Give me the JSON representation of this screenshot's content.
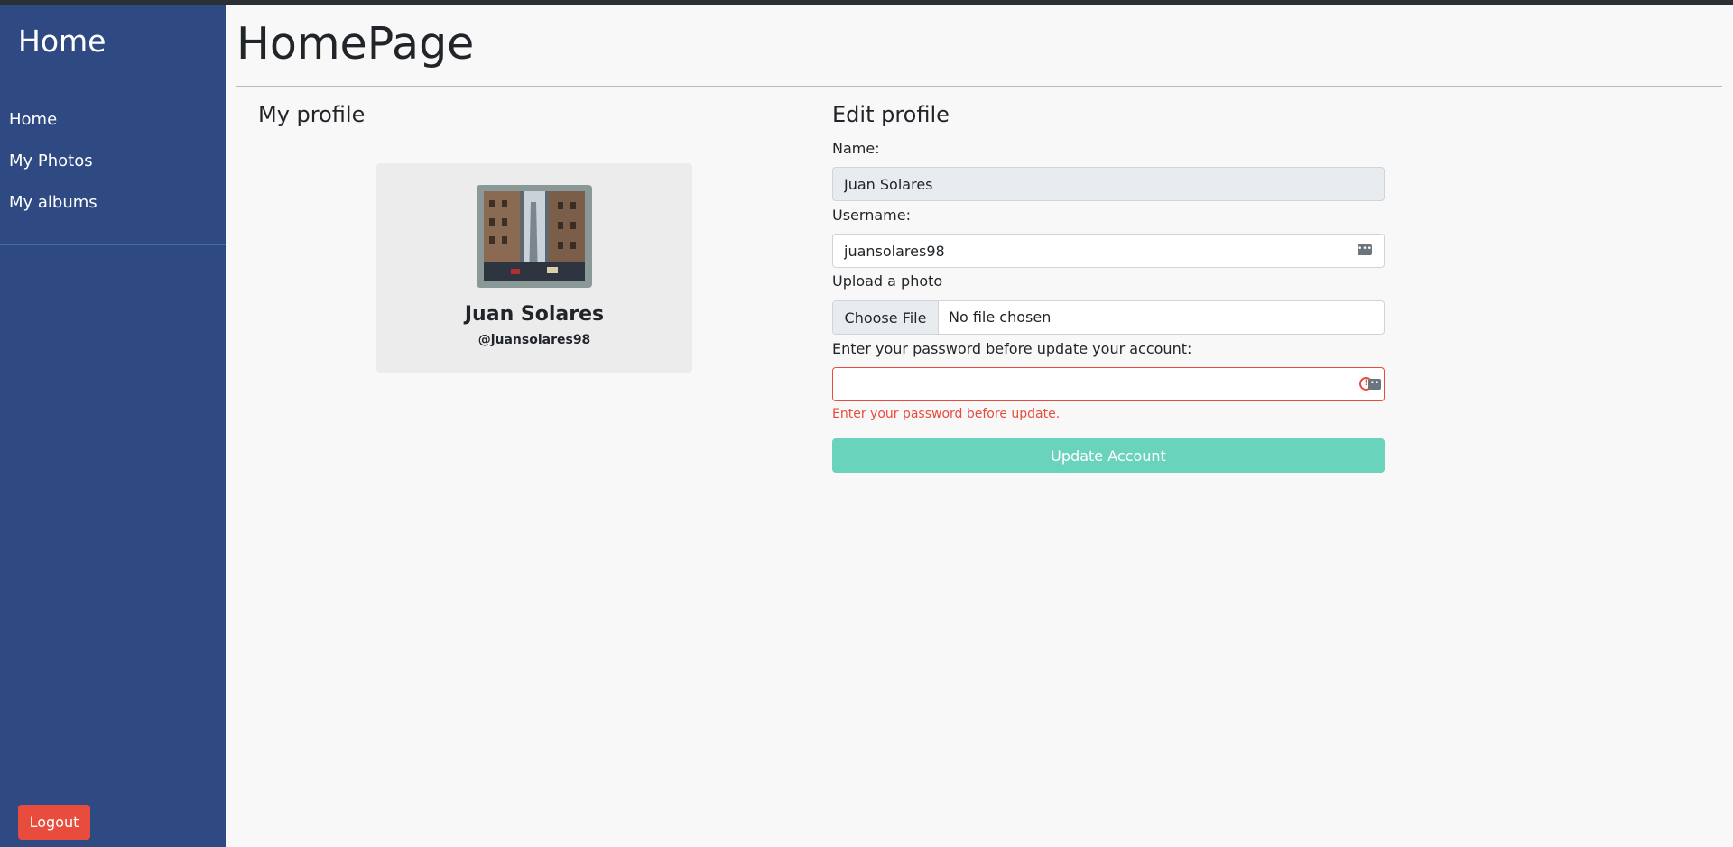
{
  "sidebar": {
    "brand": "Home",
    "items": [
      {
        "label": "Home"
      },
      {
        "label": "My Photos"
      },
      {
        "label": "My albums"
      }
    ],
    "logout_label": "Logout"
  },
  "page": {
    "title": "HomePage"
  },
  "profile": {
    "heading": "My profile",
    "name": "Juan Solares",
    "username": "@juansolares98"
  },
  "edit": {
    "heading": "Edit profile",
    "name_label": "Name:",
    "name_value": "Juan Solares",
    "username_label": "Username:",
    "username_value": "juansolares98",
    "photo_label": "Upload a photo",
    "choose_file_label": "Choose File",
    "file_status": "No file chosen",
    "password_label": "Enter your password before update your account:",
    "password_value": "",
    "password_error": "Enter your password before update.",
    "submit_label": "Update Account"
  },
  "colors": {
    "sidebar_bg": "#2f4a82",
    "logout_bg": "#e74c3c",
    "submit_bg": "#6ad3bc",
    "error": "#e74c3c"
  },
  "icons": {
    "username_field": "password-manager-icon",
    "password_field": "warning-icon"
  }
}
